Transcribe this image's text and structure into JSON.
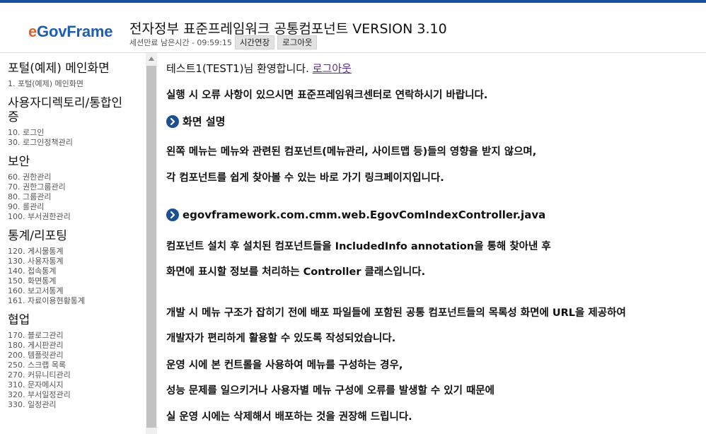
{
  "header": {
    "logo_e": "e",
    "logo_rest": "GovFrame",
    "title": "전자정부 표준프레임워크 공통컴포넌트 VERSION 3.10",
    "session_text": "세션만료 남은시간 - 09:59:15",
    "extend_label": "시간연장",
    "logout_label": "로그아웃"
  },
  "sidebar": {
    "sections": [
      {
        "title": "포털(예제) 메인화면",
        "items": [
          "1. 포털(예제) 메인화면"
        ]
      },
      {
        "title": "사용자디렉토리/통합인증",
        "items": [
          "10. 로그인",
          "30. 로그인정책관리"
        ]
      },
      {
        "title": "보안",
        "items": [
          "60. 권한관리",
          "70. 권한그룹관리",
          "80. 그룹관리",
          "90. 롤관리",
          "100. 부서권한관리"
        ]
      },
      {
        "title": "통계/리포팅",
        "items": [
          "120. 게시물통계",
          "130. 사용자통계",
          "140. 접속통계",
          "150. 화면통계",
          "160. 보고서통계",
          "161. 자료이용현황통계"
        ]
      },
      {
        "title": "협업",
        "items": [
          "170. 블로그관리",
          "180. 게시판관리",
          "200. 템플릿관리",
          "250. 스크랩 목록",
          "270. 커뮤니티관리",
          "310. 문자메시지",
          "320. 부서일정관리",
          "330. 일정관리"
        ]
      }
    ]
  },
  "content": {
    "welcome_text": "테스트1(TEST1)님 환영합니다.",
    "welcome_logout": "로그아웃",
    "notice": "실행 시 오류 사항이 있으시면 표준프레임워크센터로 연락하시기 바랍니다.",
    "section1_title": "화면 설명",
    "section1_line1": "왼쪽 메뉴는 메뉴와 관련된 컴포넌트(메뉴관리, 사이트맵 등)들의 영향을 받지 않으며,",
    "section1_line2": "각 컴포넌트를 쉽게 찾아볼 수 있는 바로 가기 링크페이지입니다.",
    "section2_title": "egovframework.com.cmm.web.EgovComIndexController.java",
    "section2_line1": "컴포넌트 설치 후 설치된 컴포넌트들을 IncludedInfo annotation을 통해 찾아낸 후",
    "section2_line2": "화면에 표시할 정보를 처리하는 Controller 클래스입니다.",
    "para3_line1": "개발 시 메뉴 구조가 잡히기 전에 배포 파일들에 포함된 공통 컴포넌트들의 목록성 화면에 URL을 제공하여",
    "para3_line2": "개발자가 편리하게 활용할 수 있도록 작성되었습니다.",
    "para3_line3": "운영 시에 본 컨트롤을 사용하여 메뉴를 구성하는 경우,",
    "para3_line4": "성능 문제를 일으키거나 사용자별 메뉴 구성에 오류를 발생할 수 있기 때문에",
    "para3_line5": "실 운영 시에는 삭제해서 배포하는 것을 권장해 드립니다."
  },
  "colors": {
    "topbar": "#1a4fa0",
    "logo_e": "#e0612a",
    "logo_blue": "#1d5db4",
    "bullet": "#1c4f91",
    "link": "#5a2a8e"
  }
}
